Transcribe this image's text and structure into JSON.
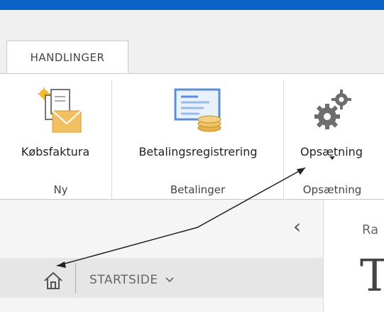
{
  "ribbon_tab": "HANDLINGER",
  "buttons": {
    "kobsfaktura": "Købsfaktura",
    "betalingsregistrering": "Betalingsregistrering",
    "opsaetning": "Opsætning"
  },
  "groups": {
    "ny": "Ny",
    "betalinger": "Betalinger",
    "opsaetning": "Opsætning"
  },
  "nav": {
    "collapse_icon": "chevron-left-icon",
    "home_icon": "home-icon",
    "breadcrumb": "STARTSIDE",
    "breadcrumb_chevron": "chevron-down-icon"
  },
  "content": {
    "partial_text": "Ra",
    "title_partial": "T"
  },
  "colors": {
    "top_bar": "#0a63c9",
    "icon_blue": "#5b8ed6",
    "icon_gold": "#e6b24f",
    "gear": "#6e6e6e"
  }
}
